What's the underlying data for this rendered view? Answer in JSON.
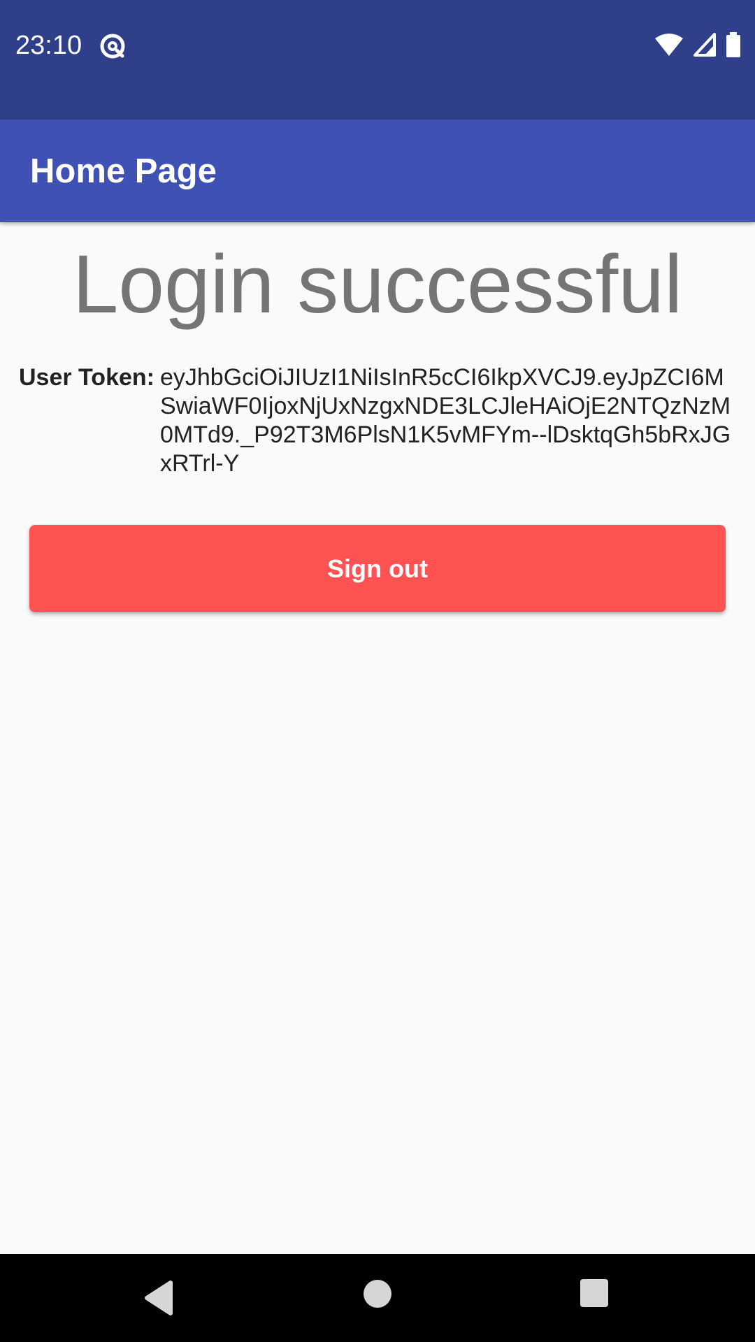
{
  "status_bar": {
    "time": "23:10",
    "app_icon": "at-sign-circle-icon",
    "icons": [
      "wifi-icon",
      "cell-signal-icon",
      "battery-icon"
    ],
    "background": "#303f8a"
  },
  "app_bar": {
    "title": "Home Page",
    "background": "#3f51b5"
  },
  "main": {
    "headline": "Login successful",
    "token_label": "User Token:",
    "token_value": "eyJhbGciOiJIUzI1NiIsInR5cCI6IkpXVCJ9.eyJpZCI6MSwiaWF0IjoxNjUxNzgxNDE3LCJleHAiOjE2NTQzNzM0MTd9._P92T3M6PlsN1K5vMFYm--lDsktqGh5bRxJGxRTrl-Y",
    "signout_label": "Sign out",
    "signout_color": "#ff5252"
  },
  "nav_bar": {
    "buttons": [
      "back-icon",
      "home-icon",
      "recents-icon"
    ]
  }
}
